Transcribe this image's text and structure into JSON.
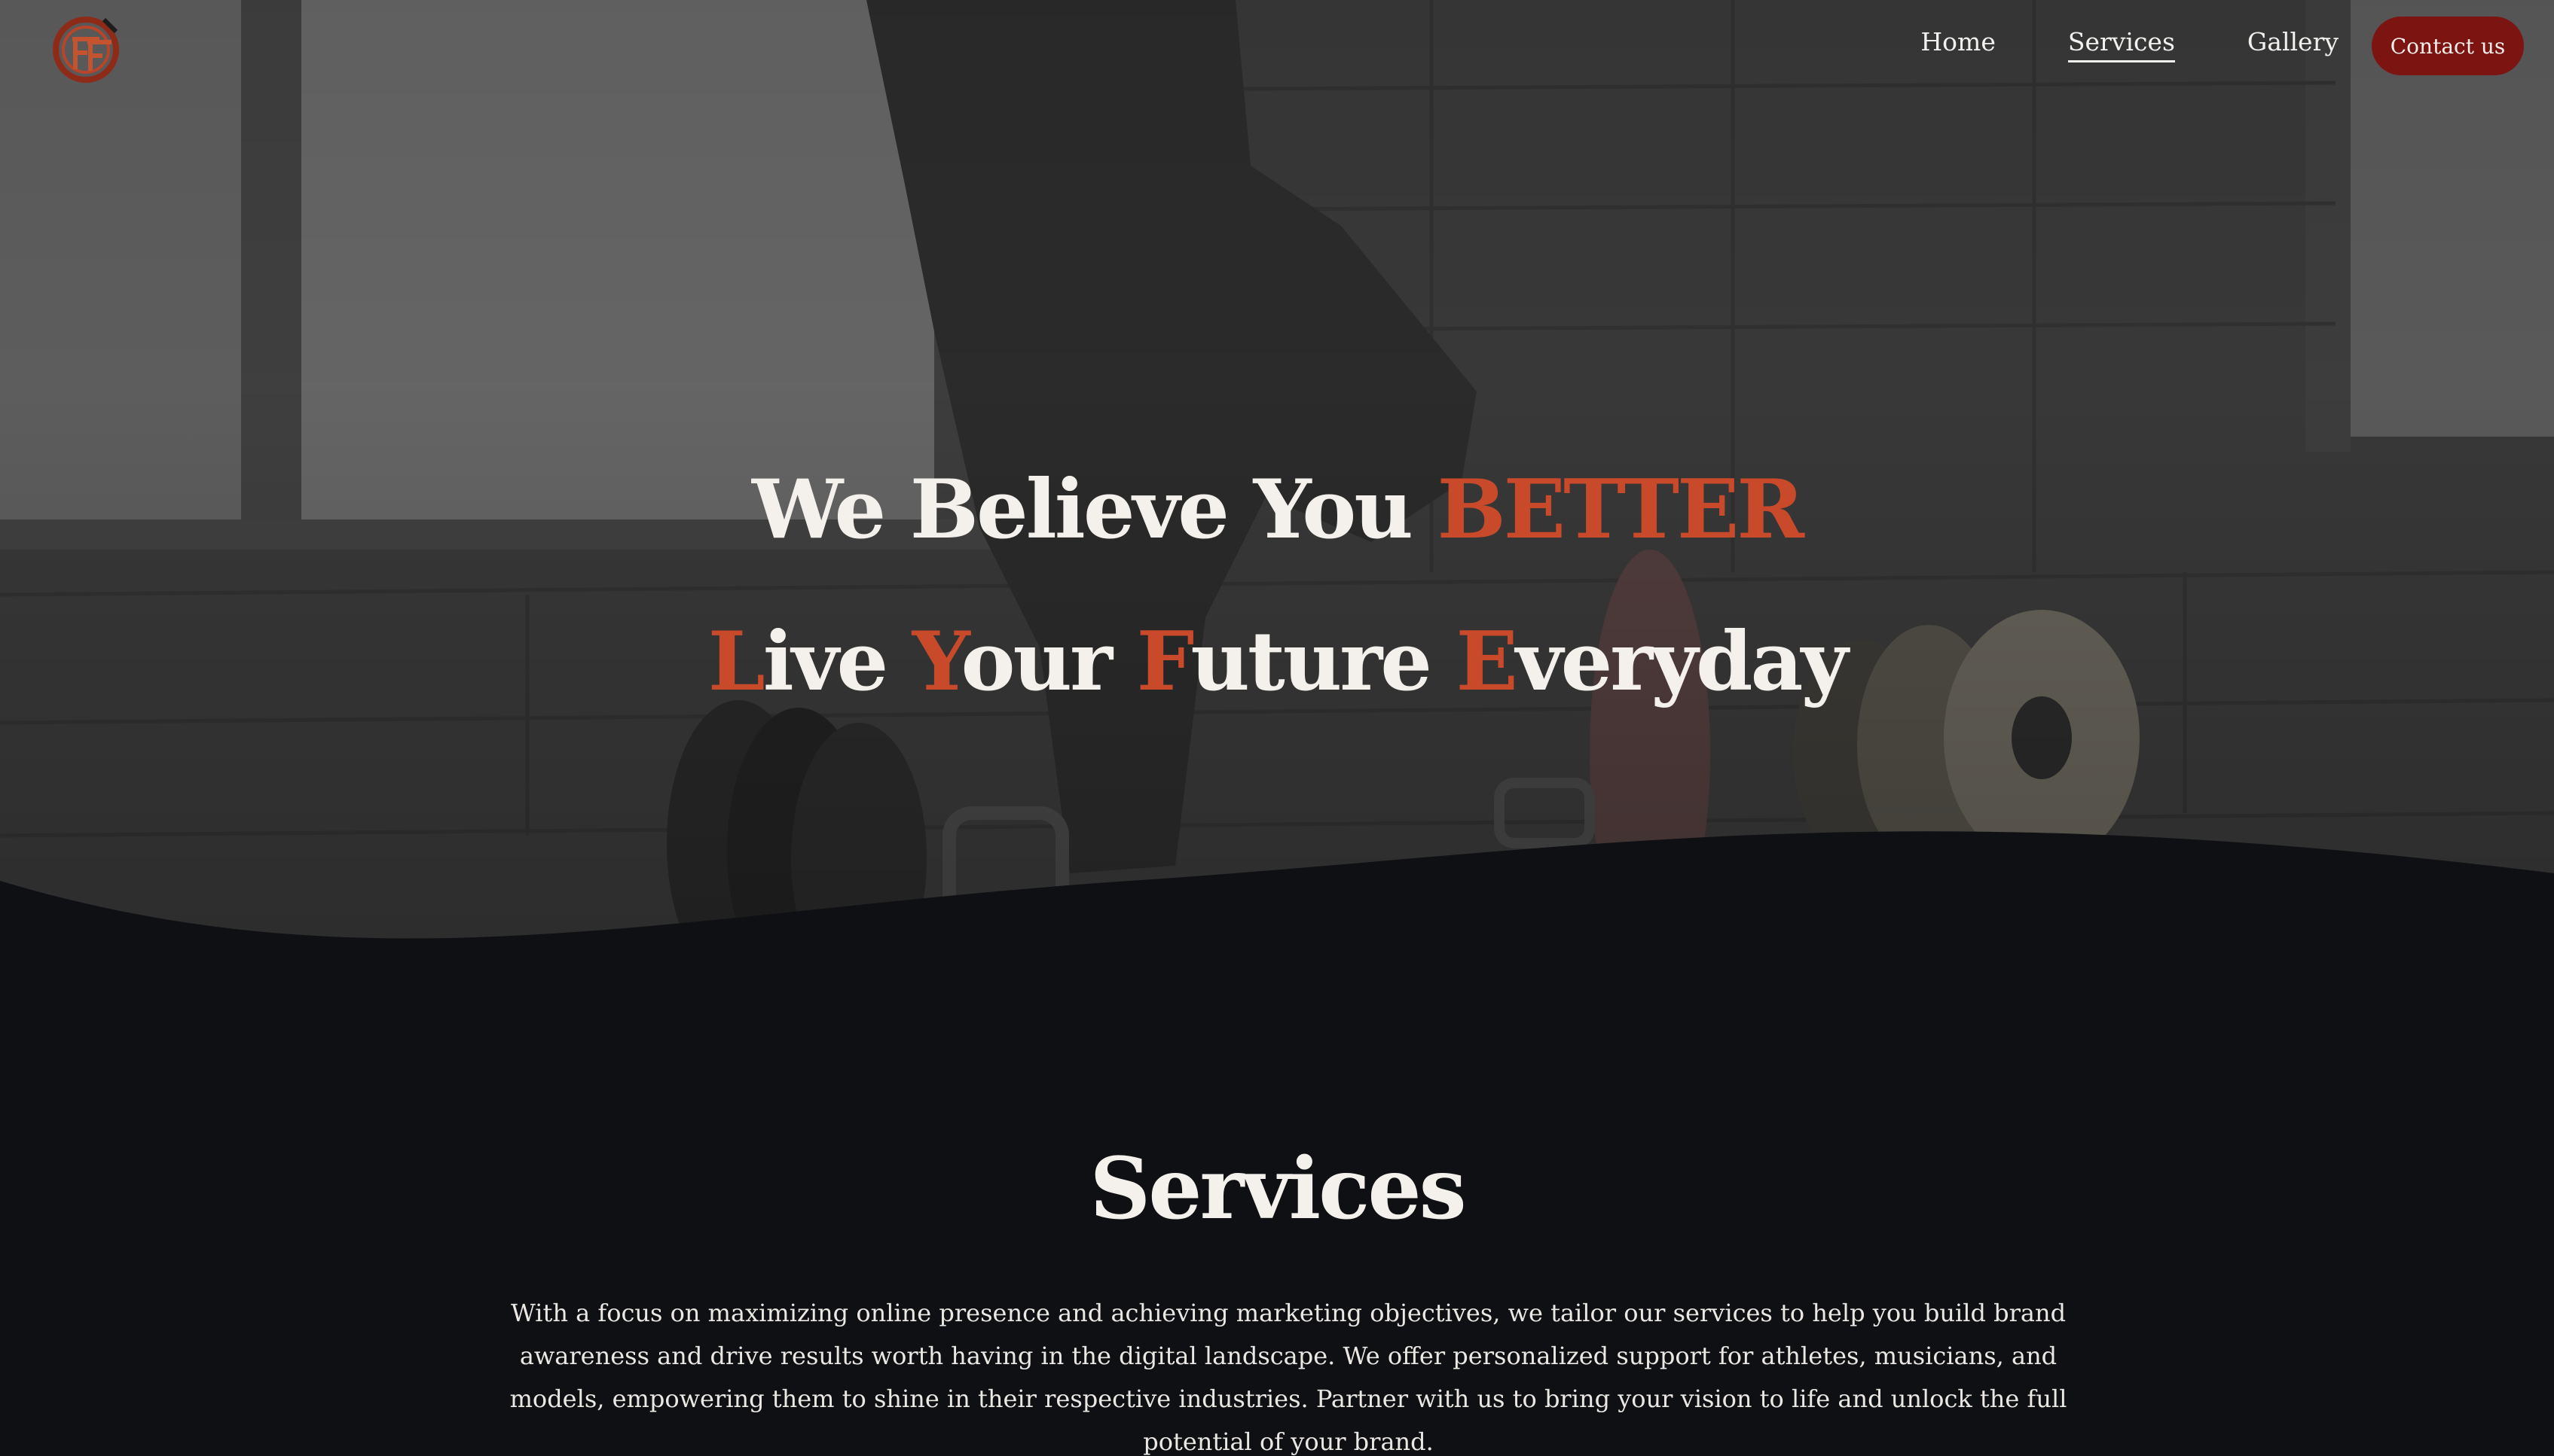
{
  "header": {
    "logo_icon": "ff-logo-icon",
    "nav": [
      {
        "label": "Home",
        "active": false
      },
      {
        "label": "Services",
        "active": true
      },
      {
        "label": "Gallery",
        "active": false
      }
    ],
    "cta_label": "Contact us",
    "cta_color": "#7c1412"
  },
  "hero": {
    "line1_main": "We Believe You ",
    "line1_accent": "BETTER",
    "line2": {
      "w1_first": "L",
      "w1_rest": "ive ",
      "w2_first": "Y",
      "w2_rest": "our ",
      "w3_first": "F",
      "w3_rest": "uture ",
      "w4_first": "E",
      "w4_rest": "veryday"
    },
    "accent_color": "#c84a2b"
  },
  "services": {
    "title": "Services",
    "body": "With a focus on maximizing online presence and achieving marketing objectives, we tailor our services to help you build brand awareness and drive results worth having in the digital landscape. We offer personalized support for athletes, musicians, and models, empowering them to shine in their respective industries. Partner with us to bring your vision to life and unlock the full potential of your brand."
  },
  "colors": {
    "page_background": "#0e1013",
    "text": "#f4f0ec"
  }
}
